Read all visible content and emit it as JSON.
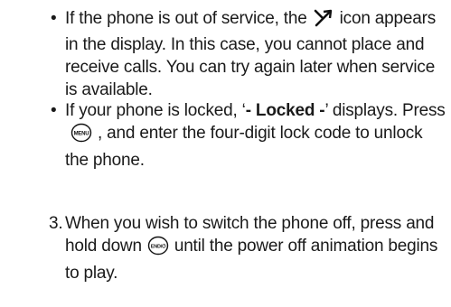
{
  "bullets": [
    {
      "marker": "•",
      "text_before": "If the phone is out of service, the",
      "icon": "no-service-icon",
      "text_after": "icon appears in the display. In this case, you cannot place and receive calls. You can try again later when service is available."
    },
    {
      "marker": "•",
      "text_before": "If your phone is locked, ‘",
      "bold": "- Locked -",
      "text_mid": "’ displays. Press",
      "key": "MENU",
      "text_after": ", and enter the four-digit lock code to unlock the phone."
    }
  ],
  "step": {
    "number": "3.",
    "text_before": "When you wish to switch the phone off, press and hold down",
    "key": "END/⏻",
    "text_after": "until the power off animation begins to play."
  }
}
